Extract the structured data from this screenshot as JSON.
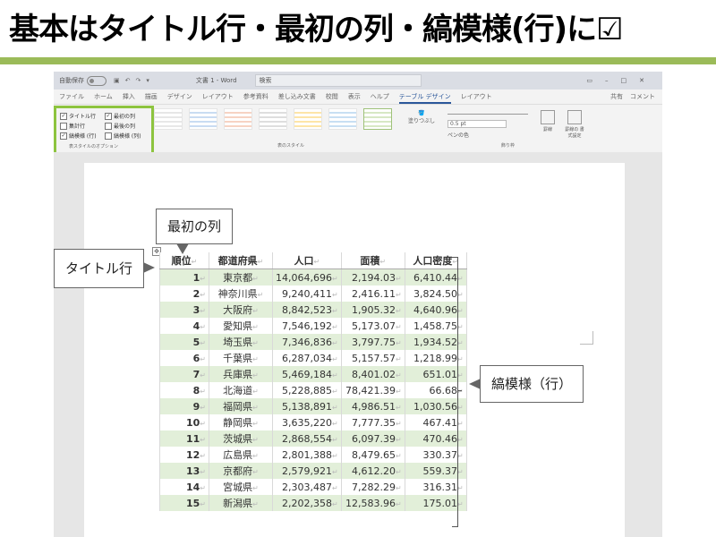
{
  "slide": {
    "title": "基本はタイトル行・最初の列・縞模様(行)に☑",
    "accent": "#9bbb59"
  },
  "word": {
    "autosave": "自動保存",
    "toggle_state": "オフ",
    "doc_title": "文書 1 - Word",
    "search_placeholder": "検索",
    "tabs": [
      "ファイル",
      "ホーム",
      "挿入",
      "描画",
      "デザイン",
      "レイアウト",
      "参考資料",
      "差し込み文書",
      "校閲",
      "表示",
      "ヘルプ",
      "テーブル デザイン",
      "レイアウト"
    ],
    "active_tab": 11,
    "share": "共有",
    "comment": "コメント",
    "options": {
      "header_row": "タイトル行",
      "first_column": "最初の列",
      "total_row": "集計行",
      "last_column": "最後の列",
      "banded_rows": "縞模様 (行)",
      "banded_columns": "縞模様 (列)",
      "group_label": "表スタイルのオプション",
      "checked": {
        "header_row": true,
        "first_column": true,
        "total_row": false,
        "last_column": false,
        "banded_rows": true,
        "banded_columns": false
      },
      "highlight": "#8dc43f"
    },
    "styles_label": "表のスタイル",
    "shading": "塗りつぶし",
    "border_style": "罫線の\nスタイル",
    "pen_weight": "0.5 pt",
    "pen_color": "ペンの色",
    "borders": "罫線",
    "border_painter": "罫線の\n書式設定",
    "borders_group": "飾り枠"
  },
  "table": {
    "headers": [
      "順位",
      "都道府県",
      "人口",
      "面積",
      "人口密度"
    ],
    "rows": [
      [
        "1",
        "東京都",
        "14,064,696",
        "2,194.03",
        "6,410.44"
      ],
      [
        "2",
        "神奈川県",
        "9,240,411",
        "2,416.11",
        "3,824.50"
      ],
      [
        "3",
        "大阪府",
        "8,842,523",
        "1,905.32",
        "4,640.96"
      ],
      [
        "4",
        "愛知県",
        "7,546,192",
        "5,173.07",
        "1,458.75"
      ],
      [
        "5",
        "埼玉県",
        "7,346,836",
        "3,797.75",
        "1,934.52"
      ],
      [
        "6",
        "千葉県",
        "6,287,034",
        "5,157.57",
        "1,218.99"
      ],
      [
        "7",
        "兵庫県",
        "5,469,184",
        "8,401.02",
        "651.01"
      ],
      [
        "8",
        "北海道",
        "5,228,885",
        "78,421.39",
        "66.68"
      ],
      [
        "9",
        "福岡県",
        "5,138,891",
        "4,986.51",
        "1,030.56"
      ],
      [
        "10",
        "静岡県",
        "3,635,220",
        "7,777.35",
        "467.41"
      ],
      [
        "11",
        "茨城県",
        "2,868,554",
        "6,097.39",
        "470.46"
      ],
      [
        "12",
        "広島県",
        "2,801,388",
        "8,479.65",
        "330.37"
      ],
      [
        "13",
        "京都府",
        "2,579,921",
        "4,612.20",
        "559.37"
      ],
      [
        "14",
        "宮城県",
        "2,303,487",
        "7,282.29",
        "316.31"
      ],
      [
        "15",
        "新潟県",
        "2,202,358",
        "12,583.96",
        "175.01"
      ]
    ],
    "band_color": "#e2efd9"
  },
  "callouts": {
    "first_column": "最初の列",
    "header_row": "タイトル行",
    "banded_rows": "縞模様（行）"
  }
}
